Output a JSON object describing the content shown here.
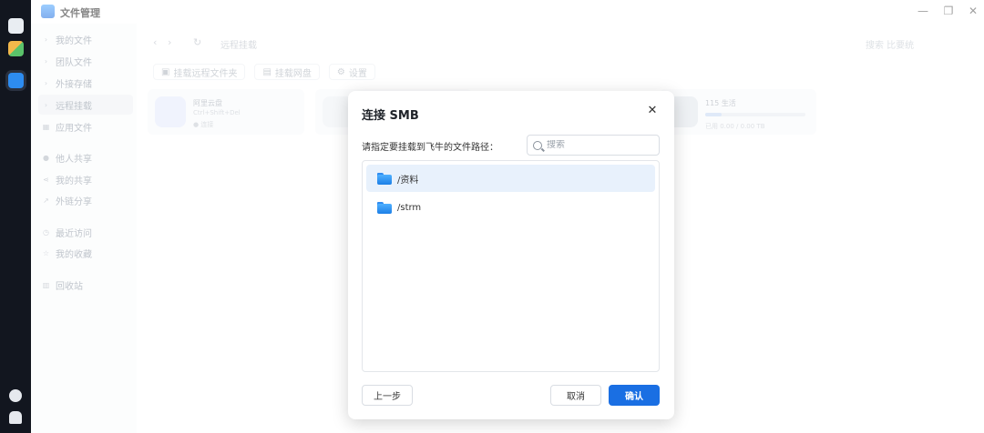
{
  "app": {
    "title": "文件管理"
  },
  "sidebar": {
    "items": [
      {
        "label": "我的文件",
        "icon": "chevron-right-icon"
      },
      {
        "label": "团队文件",
        "icon": "chevron-right-icon"
      },
      {
        "label": "外接存储",
        "icon": "chevron-right-icon"
      },
      {
        "label": "远程挂载",
        "icon": "chevron-right-icon",
        "active": true
      },
      {
        "label": "应用文件",
        "icon": "grid-icon"
      },
      {
        "label": "他人共享",
        "icon": "users-icon"
      },
      {
        "label": "我的共享",
        "icon": "share-icon"
      },
      {
        "label": "外链分享",
        "icon": "link-icon"
      },
      {
        "label": "最近访问",
        "icon": "clock-icon"
      },
      {
        "label": "我的收藏",
        "icon": "star-icon"
      },
      {
        "label": "回收站",
        "icon": "trash-icon"
      }
    ]
  },
  "main": {
    "path": "远程挂载",
    "search_placeholder": "搜索 比要统",
    "actions": [
      {
        "label": "挂载远程文件夹",
        "icon": "folder-link-icon"
      },
      {
        "label": "挂载网盘",
        "icon": "cloud-disk-icon"
      },
      {
        "label": "设置",
        "icon": "gear-icon"
      }
    ],
    "cards": [
      {
        "title": "阿里云盘",
        "subtitle": "Ctrl+Shift+Del",
        "status": "● 连接",
        "color": "#e6ecfb"
      },
      {
        "title": "",
        "subtitle": "",
        "status": "",
        "color": "#eef1f6"
      },
      {
        "title": "115 生活",
        "subtitle": "已用 0.00 / 0.00 TB",
        "status": "",
        "progress": 0.16,
        "color": "#e6eaf1"
      }
    ]
  },
  "dialog": {
    "title": "连接 SMB",
    "prompt": "请指定要挂载到飞牛的文件路径：",
    "search_placeholder": "搜索",
    "files": [
      {
        "name": "/资料",
        "selected": true
      },
      {
        "name": "/strm",
        "selected": false
      }
    ],
    "back_label": "上一步",
    "cancel_label": "取消",
    "confirm_label": "确认"
  },
  "colors": {
    "accent": "#1a6fe3",
    "selected_row": "#e8f1fc",
    "dock": "#12161f"
  }
}
